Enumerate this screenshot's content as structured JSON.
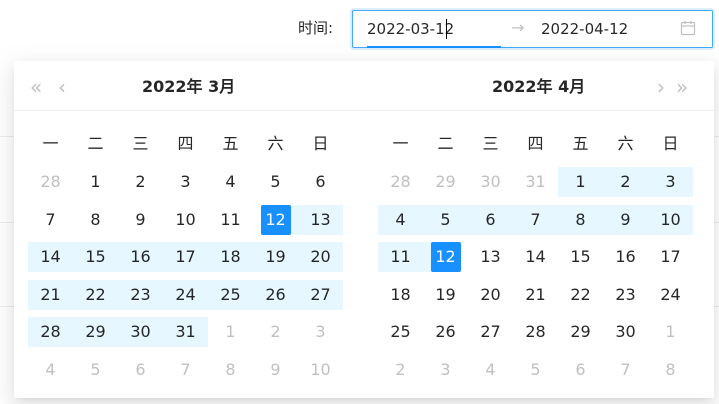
{
  "field": {
    "label": "时间:",
    "start_value": "2022-03-12",
    "end_value": "2022-04-12",
    "separator": "→",
    "icon": "calendar-icon"
  },
  "calendar": {
    "nav": {
      "super_prev": "«",
      "prev": "‹",
      "next": "›",
      "super_next": "»"
    },
    "weekdays": [
      "一",
      "二",
      "三",
      "四",
      "五",
      "六",
      "日"
    ],
    "colors": {
      "accent": "#1890ff",
      "range_bg": "#e6f7ff",
      "muted": "#c0c0c0"
    },
    "panels": [
      {
        "title": "2022年  3月",
        "rows": [
          [
            {
              "d": "28",
              "o": true
            },
            {
              "d": "1"
            },
            {
              "d": "2"
            },
            {
              "d": "3"
            },
            {
              "d": "4"
            },
            {
              "d": "5"
            },
            {
              "d": "6"
            }
          ],
          [
            {
              "d": "7"
            },
            {
              "d": "8"
            },
            {
              "d": "9"
            },
            {
              "d": "10"
            },
            {
              "d": "11"
            },
            {
              "d": "12",
              "s": true
            },
            {
              "d": "13",
              "r": true
            }
          ],
          [
            {
              "d": "14",
              "r": true
            },
            {
              "d": "15",
              "r": true
            },
            {
              "d": "16",
              "r": true
            },
            {
              "d": "17",
              "r": true
            },
            {
              "d": "18",
              "r": true
            },
            {
              "d": "19",
              "r": true
            },
            {
              "d": "20",
              "r": true
            }
          ],
          [
            {
              "d": "21",
              "r": true
            },
            {
              "d": "22",
              "r": true
            },
            {
              "d": "23",
              "r": true
            },
            {
              "d": "24",
              "r": true
            },
            {
              "d": "25",
              "r": true
            },
            {
              "d": "26",
              "r": true
            },
            {
              "d": "27",
              "r": true
            }
          ],
          [
            {
              "d": "28",
              "r": true
            },
            {
              "d": "29",
              "r": true
            },
            {
              "d": "30",
              "r": true
            },
            {
              "d": "31",
              "r": true
            },
            {
              "d": "1",
              "o": true
            },
            {
              "d": "2",
              "o": true
            },
            {
              "d": "3",
              "o": true
            }
          ],
          [
            {
              "d": "4",
              "o": true
            },
            {
              "d": "5",
              "o": true
            },
            {
              "d": "6",
              "o": true
            },
            {
              "d": "7",
              "o": true
            },
            {
              "d": "8",
              "o": true
            },
            {
              "d": "9",
              "o": true
            },
            {
              "d": "10",
              "o": true
            }
          ]
        ]
      },
      {
        "title": "2022年  4月",
        "rows": [
          [
            {
              "d": "28",
              "o": true
            },
            {
              "d": "29",
              "o": true
            },
            {
              "d": "30",
              "o": true
            },
            {
              "d": "31",
              "o": true
            },
            {
              "d": "1",
              "r": true
            },
            {
              "d": "2",
              "r": true
            },
            {
              "d": "3",
              "r": true
            }
          ],
          [
            {
              "d": "4",
              "r": true
            },
            {
              "d": "5",
              "r": true
            },
            {
              "d": "6",
              "r": true
            },
            {
              "d": "7",
              "r": true
            },
            {
              "d": "8",
              "r": true
            },
            {
              "d": "9",
              "r": true
            },
            {
              "d": "10",
              "r": true
            }
          ],
          [
            {
              "d": "11",
              "r": true
            },
            {
              "d": "12",
              "s": true
            },
            {
              "d": "13"
            },
            {
              "d": "14"
            },
            {
              "d": "15"
            },
            {
              "d": "16"
            },
            {
              "d": "17"
            }
          ],
          [
            {
              "d": "18"
            },
            {
              "d": "19"
            },
            {
              "d": "20"
            },
            {
              "d": "21"
            },
            {
              "d": "22"
            },
            {
              "d": "23"
            },
            {
              "d": "24"
            }
          ],
          [
            {
              "d": "25"
            },
            {
              "d": "26"
            },
            {
              "d": "27"
            },
            {
              "d": "28"
            },
            {
              "d": "29"
            },
            {
              "d": "30"
            },
            {
              "d": "1",
              "o": true
            }
          ],
          [
            {
              "d": "2",
              "o": true
            },
            {
              "d": "3",
              "o": true
            },
            {
              "d": "4",
              "o": true
            },
            {
              "d": "5",
              "o": true
            },
            {
              "d": "6",
              "o": true
            },
            {
              "d": "7",
              "o": true
            },
            {
              "d": "8",
              "o": true
            }
          ]
        ]
      }
    ]
  }
}
